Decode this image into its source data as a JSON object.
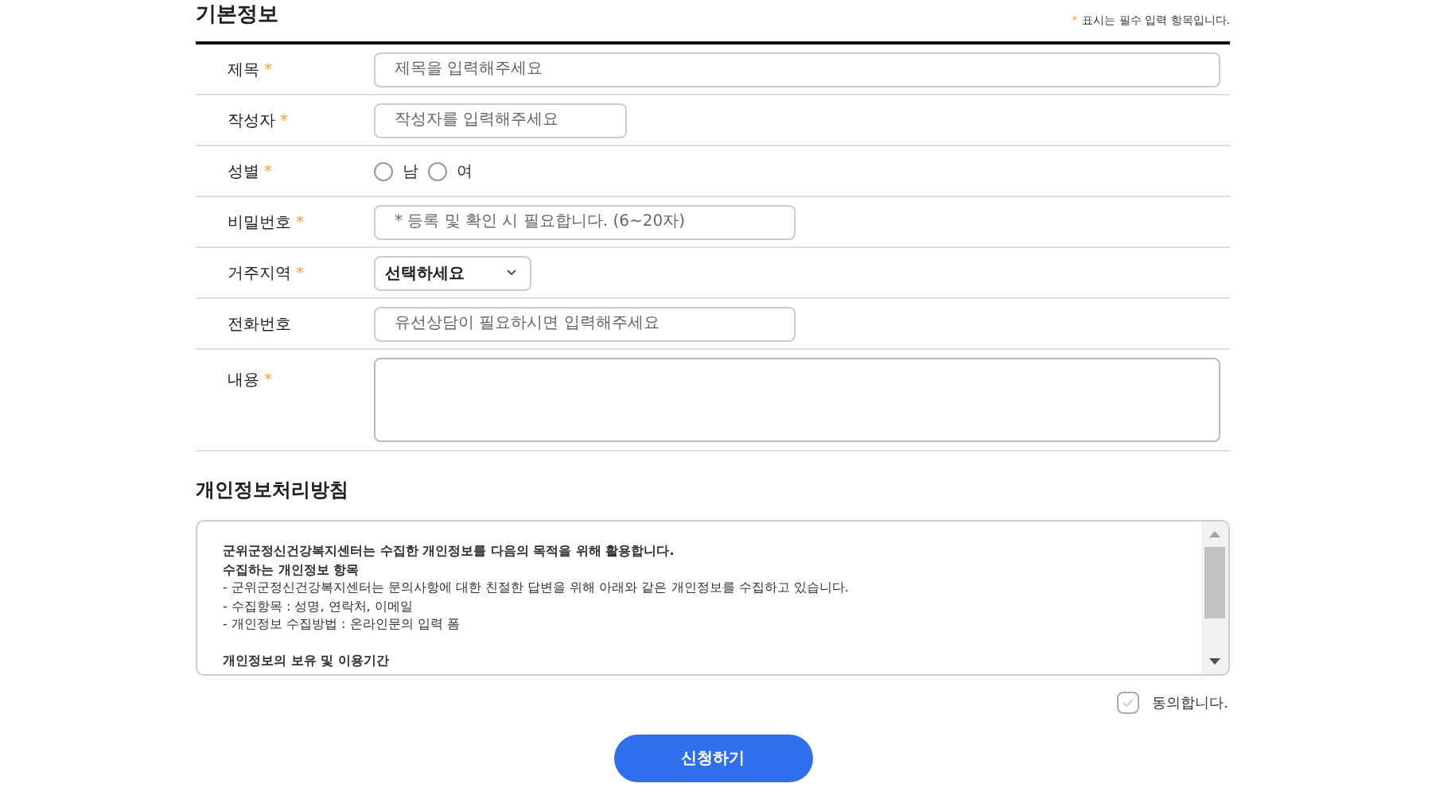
{
  "basic_info": {
    "title": "기본정보",
    "required_note": {
      "mark": "*",
      "text": "표시는 필수 입력 항목입니다."
    },
    "fields": [
      {
        "kind": "text",
        "label": "제목",
        "mark": "*",
        "placeholder": "제목을 입력해주세요"
      },
      {
        "kind": "text",
        "label": "작성자",
        "mark": "*",
        "placeholder": "작성자를 입력해주세요"
      },
      {
        "kind": "radio",
        "label": "성별",
        "mark": "*",
        "options": [
          {
            "label": "남",
            "selected": false
          },
          {
            "label": "여",
            "selected": false
          }
        ]
      },
      {
        "kind": "text",
        "label": "비밀번호",
        "mark": "*",
        "placeholder": "* 등록 및 확인 시 필요합니다. (6~20자)"
      },
      {
        "kind": "select",
        "label": "거주지역",
        "mark": "*",
        "value": "선택하세요"
      },
      {
        "kind": "text",
        "label": "전화번호",
        "placeholder": "유선상담이 필요하시면 입력해주세요"
      },
      {
        "kind": "textarea",
        "label": "내용",
        "mark": "*"
      }
    ]
  },
  "privacy": {
    "title": "개인정보처리방침",
    "lines": [
      {
        "kind": "heading",
        "text": "군위군정신건강복지센터는 수집한 개인정보를 다음의 목적을 위해 활용합니다."
      },
      {
        "kind": "heading",
        "text": "수집하는 개인정보 항목"
      },
      {
        "kind": "item",
        "text": "- 군위군정신건강복지센터는 문의사항에 대한 친절한 답변을 위해 아래와 같은 개인정보를 수집하고 있습니다."
      },
      {
        "kind": "item",
        "text": "- 수집항목 : 성명, 연락처, 이메일"
      },
      {
        "kind": "item",
        "text": "- 개인정보 수집방법 : 온라인문의 입력 폼"
      },
      {
        "kind": "section",
        "text": "개인정보의 보유 및 이용기간"
      }
    ],
    "agree": {
      "label": "동의합니다.",
      "checked": false
    }
  },
  "submit": "신청하기"
}
